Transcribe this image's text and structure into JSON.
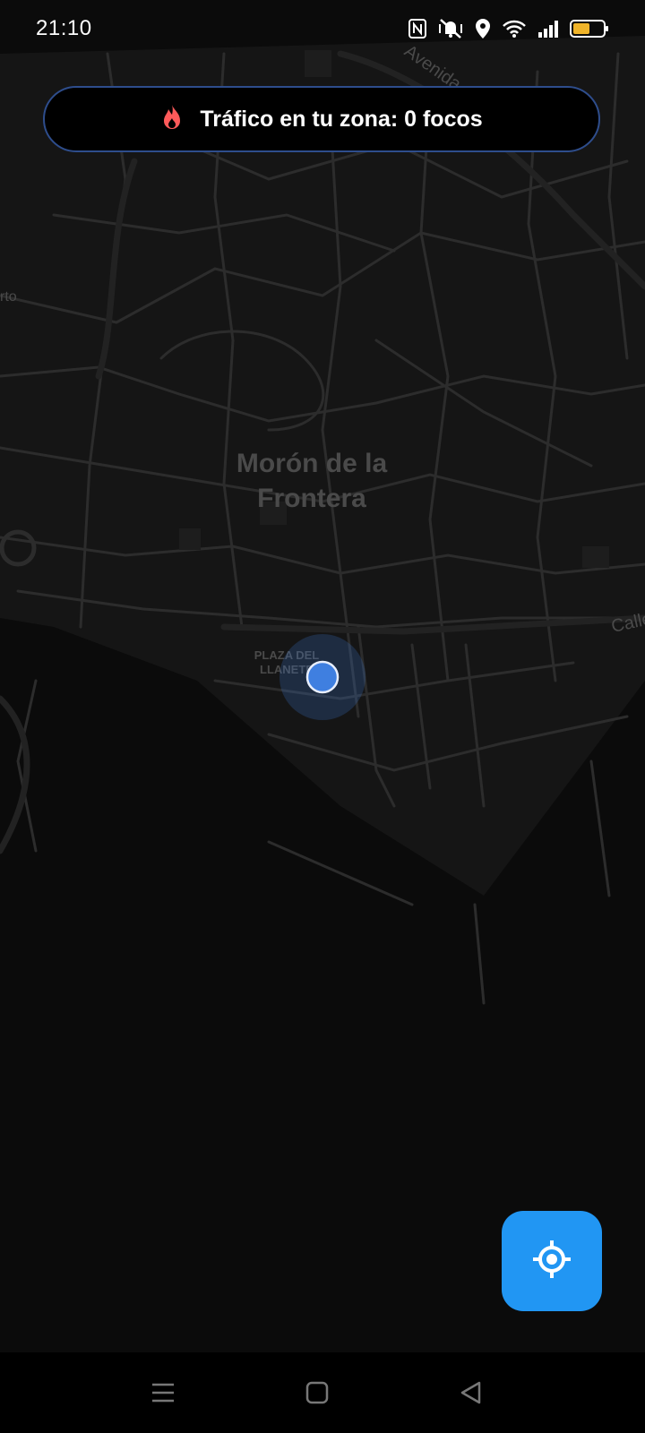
{
  "status_bar": {
    "time": "21:10",
    "icons": [
      "nfc-icon",
      "vibrate-off-icon",
      "location-icon",
      "wifi-icon",
      "signal-icon",
      "battery-icon"
    ],
    "battery_color": "#f0b429"
  },
  "banner": {
    "icon": "fire-icon",
    "icon_color": "#ff5a5a",
    "text": "Tráfico en tu zona: 0 focos"
  },
  "map": {
    "city_label_line1": "Morón de la",
    "city_label_line2": "Frontera",
    "plaza_label_line1": "PLAZA DEL",
    "plaza_label_line2": "LLANETE",
    "street_label_avenida": "Avenida",
    "street_label_calle": "Calle",
    "street_label_left": "rto",
    "user_location_color": "#3f7fe0"
  },
  "locate_button": {
    "icon": "my-location-icon",
    "color": "#2196f3"
  },
  "nav_bar": {
    "items": [
      "menu-icon",
      "home-icon",
      "back-icon"
    ]
  }
}
